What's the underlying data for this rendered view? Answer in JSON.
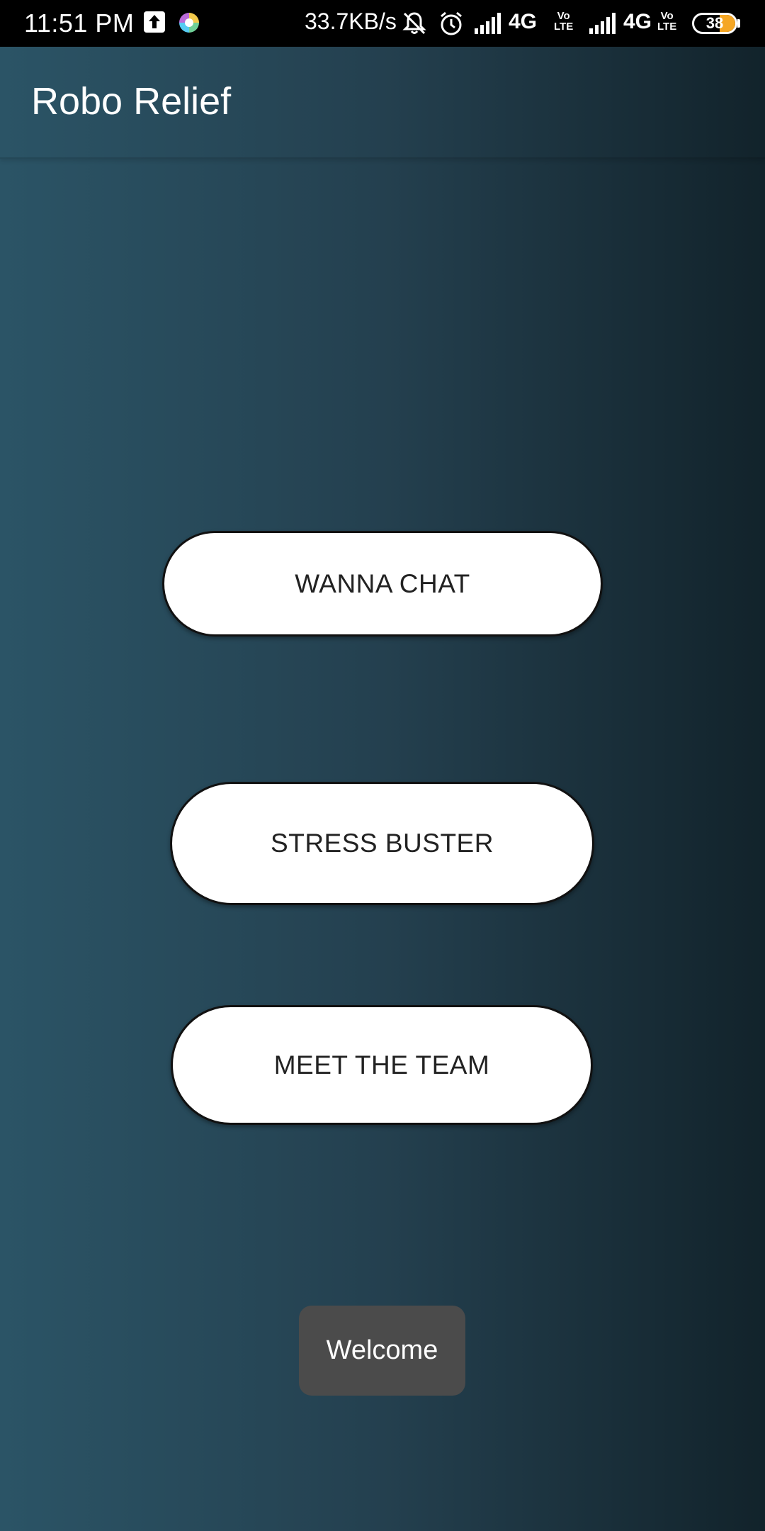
{
  "status_bar": {
    "time": "11:51 PM",
    "net_speed": "33.7KB/s",
    "icons": [
      "upload-icon",
      "app-notification-icon",
      "mute-bell-icon",
      "alarm-icon",
      "signal-icon",
      "signal-icon"
    ],
    "network_1": "4G",
    "network_2": "4G",
    "volte_top": "Vo",
    "volte_bottom": "LTE",
    "battery_level": "38",
    "battery_fraction": 0.38,
    "battery_color": "#f5a623"
  },
  "app_bar": {
    "title": "Robo Relief"
  },
  "main": {
    "buttons": [
      {
        "label": "WANNA CHAT"
      },
      {
        "label": "STRESS BUSTER"
      },
      {
        "label": "MEET THE TEAM"
      }
    ]
  },
  "toast": {
    "message": "Welcome"
  },
  "colors": {
    "background_left": "#2b5466",
    "background_right": "#12232b",
    "button_bg": "#ffffff",
    "toast_bg": "#4b4b4b"
  }
}
